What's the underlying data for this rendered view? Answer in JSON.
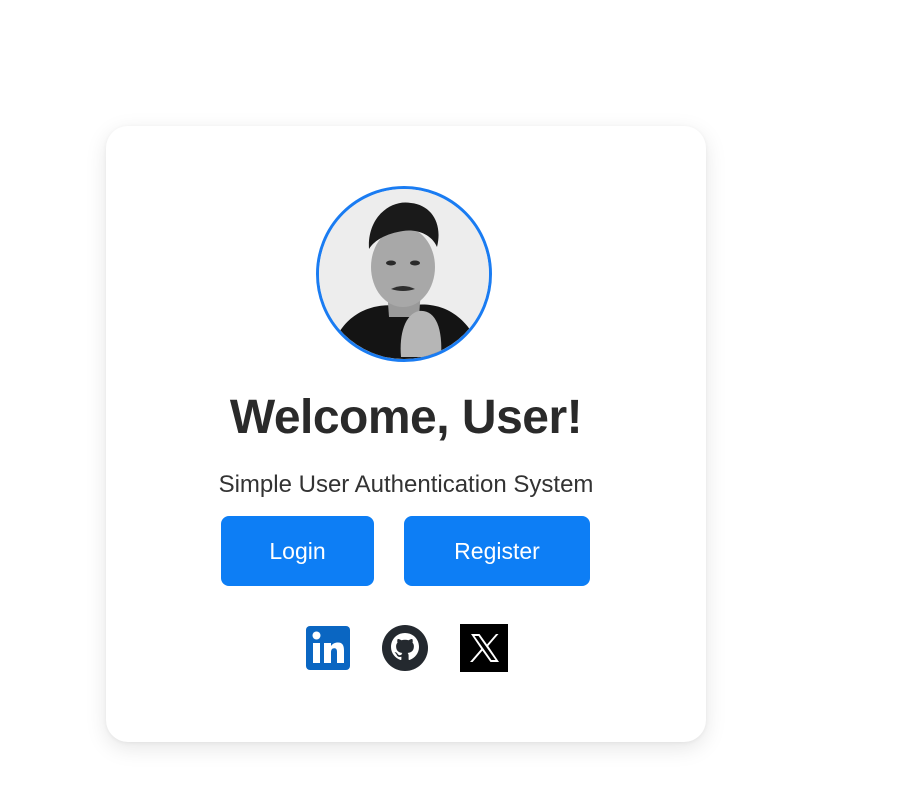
{
  "card": {
    "title": "Welcome, User!",
    "subtitle": "Simple User Authentication System"
  },
  "buttons": {
    "login_label": "Login",
    "register_label": "Register"
  },
  "socials": [
    {
      "icon": "linkedin-icon",
      "color": "#0a66c2"
    },
    {
      "icon": "github-icon",
      "color": "#24292f"
    },
    {
      "icon": "x-icon",
      "color": "#000000"
    }
  ],
  "colors": {
    "accent": "#0d7ef5",
    "avatar_border": "#1a7cf2",
    "title_text": "#2a2a2a"
  }
}
